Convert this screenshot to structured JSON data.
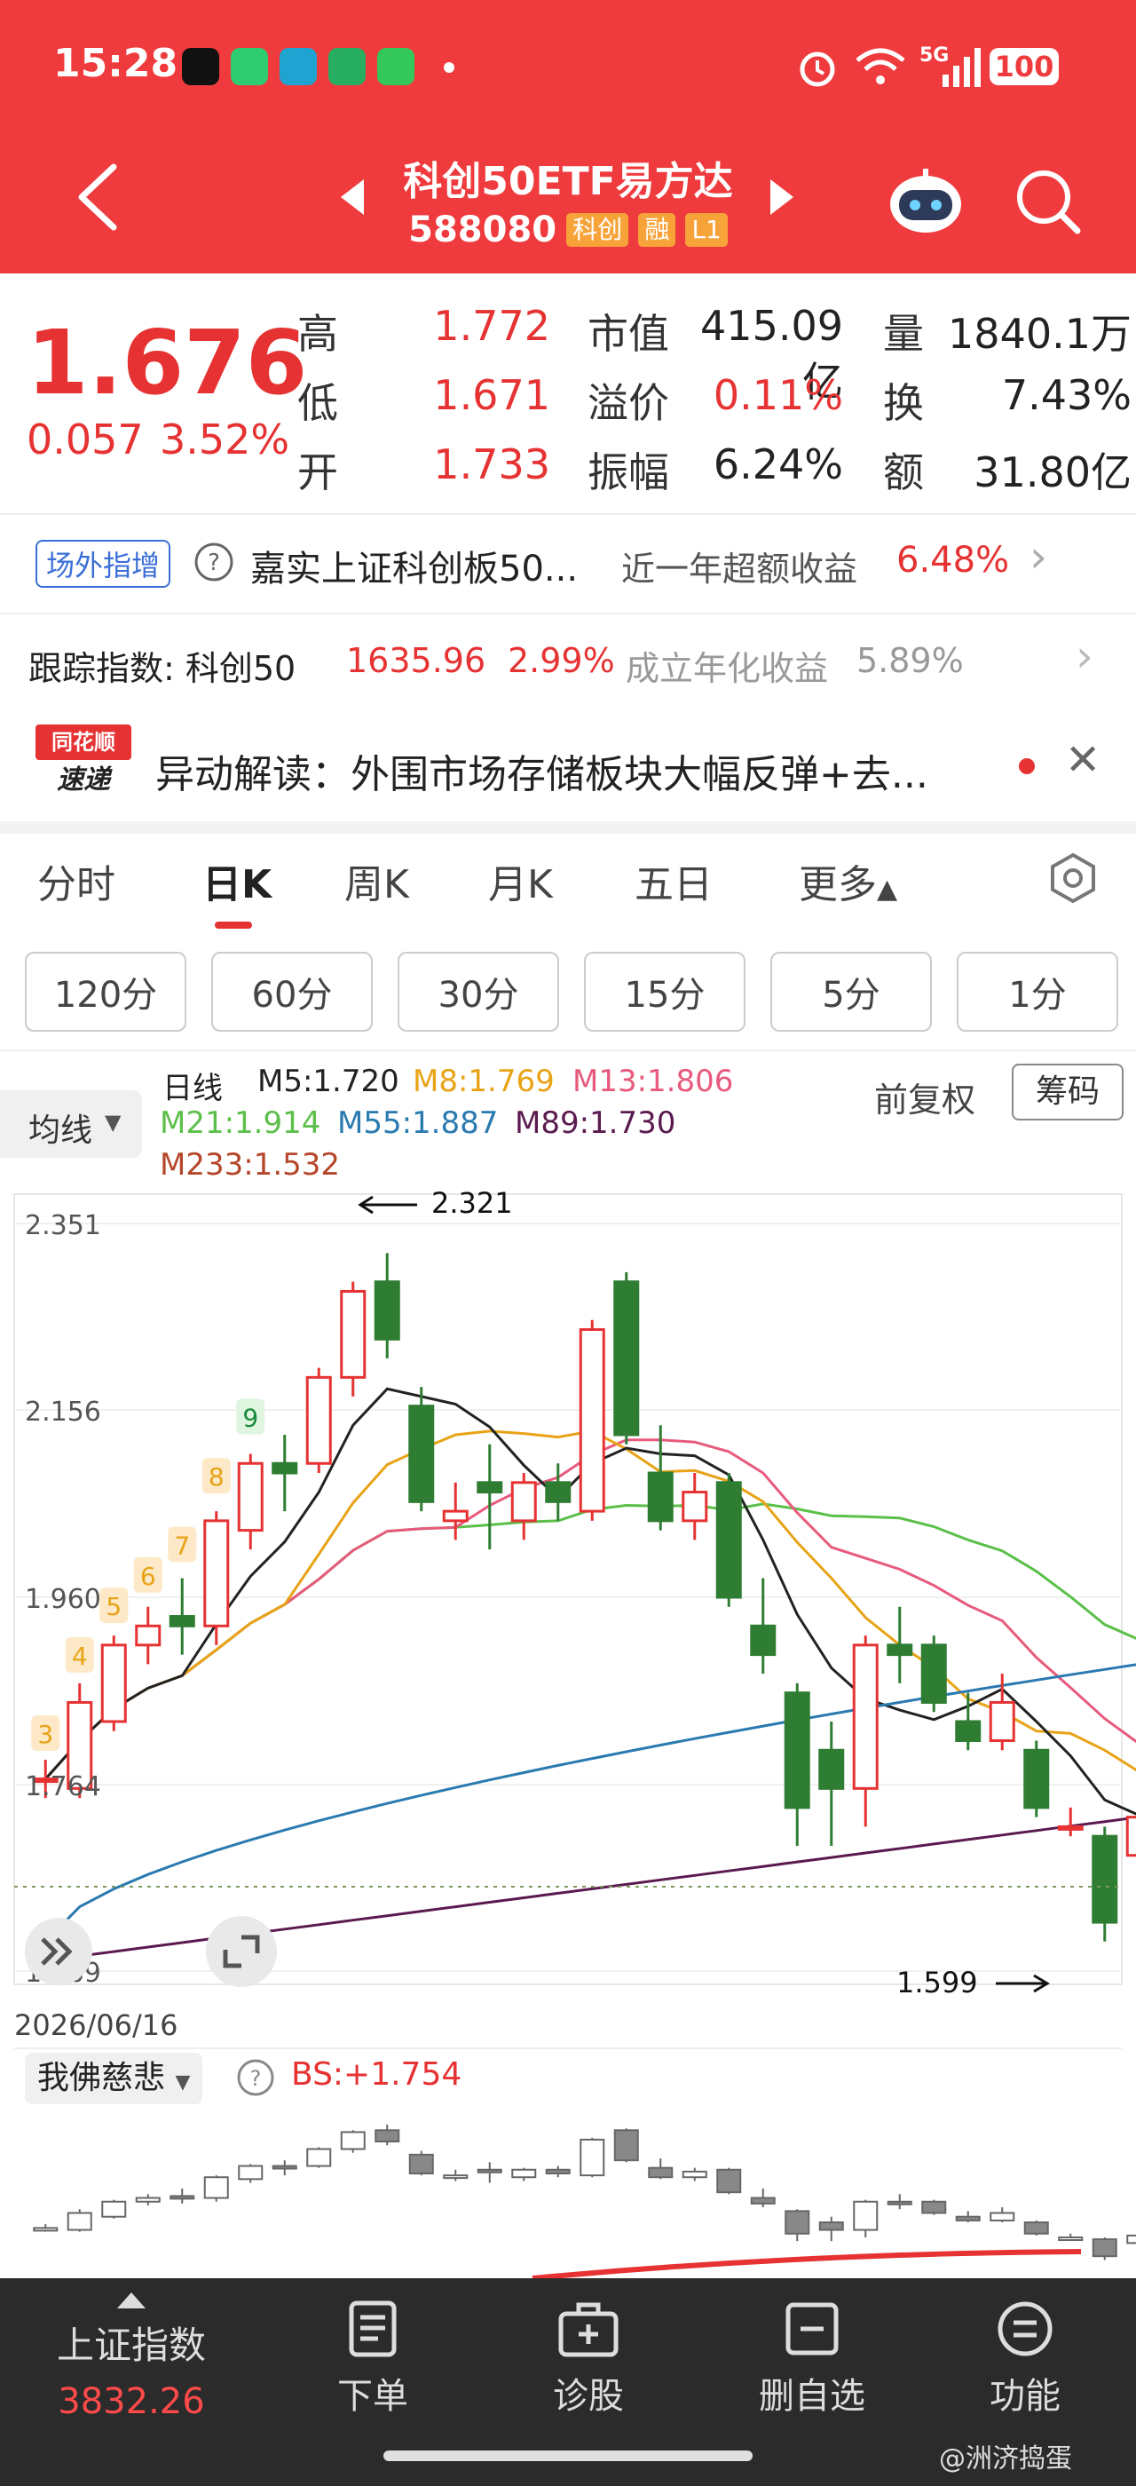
{
  "status_bar": {
    "time": "15:28",
    "network": "5G",
    "battery": "100"
  },
  "header": {
    "title": "科创50ETF易方达",
    "code": "588080",
    "tags": [
      "科创",
      "融",
      "L1"
    ]
  },
  "quote": {
    "price": "1.676",
    "change": "0.057",
    "change_pct": "3.52%",
    "rows": [
      {
        "l1": "高",
        "v1": "1.772",
        "l2": "市值",
        "v2": "415.09亿",
        "l3": "量",
        "v3": "1840.1万"
      },
      {
        "l1": "低",
        "v1": "1.671",
        "l2": "溢价",
        "v2": "0.11%",
        "l3": "换",
        "v3": "7.43%"
      },
      {
        "l1": "开",
        "v1": "1.733",
        "l2": "振幅",
        "v2": "6.24%",
        "l3": "额",
        "v3": "31.80亿"
      }
    ]
  },
  "offsite": {
    "badge": "场外指增",
    "fund_name": "嘉实上证科创板50...",
    "return_label": "近一年超额收益",
    "return_value": "6.48%"
  },
  "tracking": {
    "label": "跟踪指数: 科创50",
    "index_value": "1635.96",
    "index_pct": "2.99%",
    "annual_label": "成立年化收益",
    "annual_value": "5.89%"
  },
  "news": {
    "logo_top": "同花顺",
    "logo_bottom": "速递",
    "text": "异动解读：外围市场存储板块大幅反弹+去..."
  },
  "period_tabs": [
    "分时",
    "日K",
    "周K",
    "月K",
    "五日",
    "更多"
  ],
  "active_tab": "日K",
  "minute_pills": [
    "120分",
    "60分",
    "30分",
    "15分",
    "5分",
    "1分"
  ],
  "ma_panel": {
    "selector": "均线",
    "line_label": "日线",
    "adjust_label": "前复权",
    "chip_button": "筹码",
    "ma": [
      {
        "label": "M5:1.720",
        "color": "#222222"
      },
      {
        "label": "M8:1.769",
        "color": "#e8a317"
      },
      {
        "label": "M13:1.806",
        "color": "#e75a7c"
      },
      {
        "label": "M21:1.914",
        "color": "#5cbf4a"
      },
      {
        "label": "M55:1.887",
        "color": "#2a7ab0"
      },
      {
        "label": "M89:1.730",
        "color": "#5b1a4f"
      },
      {
        "label": "M233:1.532",
        "color": "#b5462a"
      }
    ]
  },
  "chart_data": {
    "type": "candlestick",
    "y_ticks": [
      "2.351",
      "2.156",
      "1.960",
      "1.764",
      "1.569"
    ],
    "ylim": [
      1.569,
      2.351
    ],
    "high_marker": "2.321",
    "low_marker": "1.599",
    "date_label": "2026/06/16",
    "seq_labels": [
      "3",
      "4",
      "5",
      "6",
      "7",
      "8",
      "9"
    ],
    "candles": [
      {
        "o": 1.77,
        "c": 1.77,
        "h": 1.79,
        "l": 1.75
      },
      {
        "o": 1.76,
        "c": 1.85,
        "h": 1.87,
        "l": 1.75
      },
      {
        "o": 1.83,
        "c": 1.91,
        "h": 1.92,
        "l": 1.82
      },
      {
        "o": 1.91,
        "c": 1.93,
        "h": 1.95,
        "l": 1.89
      },
      {
        "o": 1.94,
        "c": 1.93,
        "h": 1.98,
        "l": 1.9
      },
      {
        "o": 1.93,
        "c": 2.04,
        "h": 2.05,
        "l": 1.91
      },
      {
        "o": 2.03,
        "c": 2.1,
        "h": 2.11,
        "l": 2.01
      },
      {
        "o": 2.1,
        "c": 2.09,
        "h": 2.13,
        "l": 2.05
      },
      {
        "o": 2.1,
        "c": 2.19,
        "h": 2.2,
        "l": 2.09
      },
      {
        "o": 2.19,
        "c": 2.28,
        "h": 2.29,
        "l": 2.17
      },
      {
        "o": 2.29,
        "c": 2.23,
        "h": 2.32,
        "l": 2.21
      },
      {
        "o": 2.16,
        "c": 2.06,
        "h": 2.18,
        "l": 2.05
      },
      {
        "o": 2.04,
        "c": 2.05,
        "h": 2.08,
        "l": 2.02
      },
      {
        "o": 2.08,
        "c": 2.07,
        "h": 2.12,
        "l": 2.01
      },
      {
        "o": 2.04,
        "c": 2.08,
        "h": 2.09,
        "l": 2.02
      },
      {
        "o": 2.08,
        "c": 2.06,
        "h": 2.1,
        "l": 2.04
      },
      {
        "o": 2.05,
        "c": 2.24,
        "h": 2.25,
        "l": 2.04
      },
      {
        "o": 2.29,
        "c": 2.13,
        "h": 2.3,
        "l": 2.12
      },
      {
        "o": 2.09,
        "c": 2.04,
        "h": 2.14,
        "l": 2.03
      },
      {
        "o": 2.04,
        "c": 2.07,
        "h": 2.09,
        "l": 2.02
      },
      {
        "o": 2.08,
        "c": 1.96,
        "h": 2.09,
        "l": 1.95
      },
      {
        "o": 1.93,
        "c": 1.9,
        "h": 1.98,
        "l": 1.88
      },
      {
        "o": 1.86,
        "c": 1.74,
        "h": 1.87,
        "l": 1.7
      },
      {
        "o": 1.8,
        "c": 1.76,
        "h": 1.83,
        "l": 1.7
      },
      {
        "o": 1.76,
        "c": 1.91,
        "h": 1.92,
        "l": 1.72
      },
      {
        "o": 1.91,
        "c": 1.9,
        "h": 1.95,
        "l": 1.87
      },
      {
        "o": 1.91,
        "c": 1.85,
        "h": 1.92,
        "l": 1.84
      },
      {
        "o": 1.83,
        "c": 1.81,
        "h": 1.86,
        "l": 1.8
      },
      {
        "o": 1.81,
        "c": 1.85,
        "h": 1.88,
        "l": 1.8
      },
      {
        "o": 1.8,
        "c": 1.74,
        "h": 1.81,
        "l": 1.73
      },
      {
        "o": 1.72,
        "c": 1.72,
        "h": 1.74,
        "l": 1.71
      },
      {
        "o": 1.71,
        "c": 1.62,
        "h": 1.72,
        "l": 1.6
      },
      {
        "o": 1.69,
        "c": 1.73,
        "h": 1.77,
        "l": 1.66
      }
    ]
  },
  "indicator": {
    "name": "我佛慈悲",
    "value": "BS:+1.754"
  },
  "tabbar": {
    "index_name": "上证指数",
    "index_value": "3832.26",
    "items": [
      "下单",
      "诊股",
      "删自选",
      "功能"
    ]
  },
  "watermark": "@洲济捣蛋",
  "colors": {
    "brand_red": "#ef3b3d",
    "up": "#e63232",
    "down": "#2e7d32"
  }
}
